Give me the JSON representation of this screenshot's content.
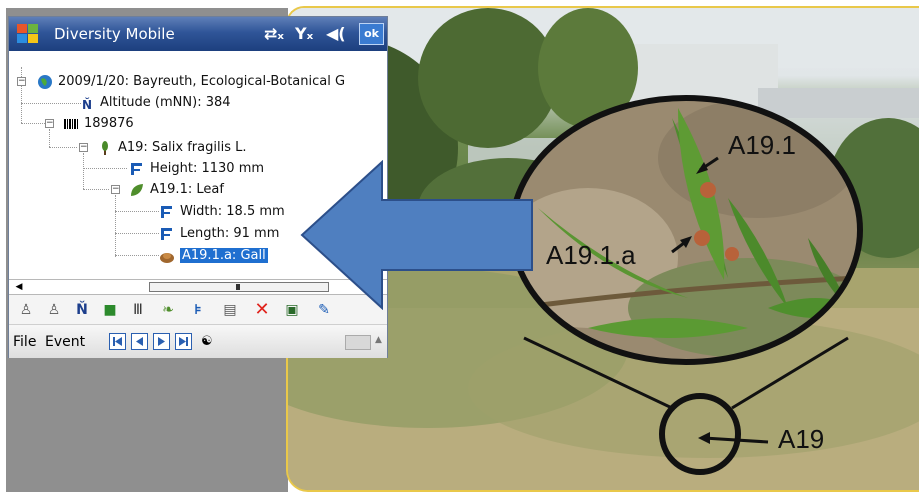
{
  "window": {
    "app_title": "Diversity Mobile",
    "ok_label": "ok"
  },
  "tree": {
    "event": "2009/1/20: Bayreuth, Ecological-Botanical G",
    "altitude": "Altitude (mNN): 384",
    "specimen": "189876",
    "unit": "A19: Salix fragilis L.",
    "height": "Height: 1130 mm",
    "part": "A19.1: Leaf",
    "width": "Width: 18.5 mm",
    "length": "Length: 91 mm",
    "gall": "A19.1.a: Gall"
  },
  "menu": {
    "file": "File",
    "event": "Event"
  },
  "callouts": {
    "leaf": "A19.1",
    "gall": "A19.1.a",
    "tree": "A19"
  },
  "colors": {
    "titlebar": "#2f5598",
    "selection": "#1f6fd0",
    "arrow": "#4f7fc0"
  },
  "icons": {
    "globe": "globe-icon",
    "altitude": "altitude-icon",
    "barcode": "barcode-icon",
    "plant": "plant-icon",
    "measure": "measure-icon",
    "leaf": "leaf-icon",
    "gall": "gall-icon",
    "binoculars": "binoculars-icon"
  }
}
